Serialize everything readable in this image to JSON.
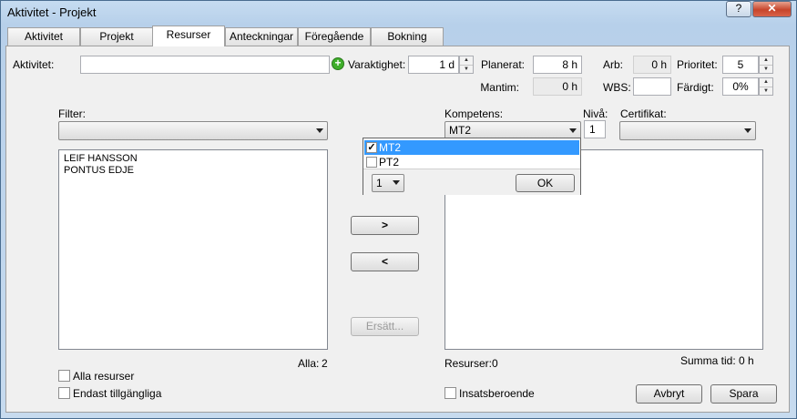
{
  "window": {
    "title": "Aktivitet - Projekt",
    "help_label": "?",
    "close_label": "✕"
  },
  "tabs": [
    {
      "label": "Aktivitet"
    },
    {
      "label": "Projekt"
    },
    {
      "label": "Resurser",
      "active": true
    },
    {
      "label": "Anteckningar"
    },
    {
      "label": "Föregående"
    },
    {
      "label": "Bokning"
    }
  ],
  "header": {
    "aktivitet_label": "Aktivitet:",
    "aktivitet_value": "",
    "varaktighet_label": "Varaktighet:",
    "varaktighet_value": "1 d",
    "planerat_label": "Planerat:",
    "planerat_value": "8 h",
    "arb_label": "Arb:",
    "arb_value": "0 h",
    "prioritet_label": "Prioritet:",
    "prioritet_value": "5",
    "mantim_label": "Mantim:",
    "mantim_value": "0 h",
    "wbs_label": "WBS:",
    "wbs_value": "",
    "fardigt_label": "Färdigt:",
    "fardigt_value": "0%"
  },
  "left": {
    "filter_label": "Filter:",
    "filter_value": "",
    "resources": [
      "LEIF HANSSON",
      "PONTUS EDJE"
    ],
    "count_label": "Alla:",
    "count_value": "2",
    "check_all": "Alla resurser",
    "check_available": "Endast tillgängliga"
  },
  "middle": {
    "add_label": ">",
    "remove_label": "<",
    "replace_label": "Ersätt..."
  },
  "right": {
    "kompetens_label": "Kompetens:",
    "kompetens_value": "MT2",
    "niva_label": "Nivå:",
    "niva_value": "1",
    "certifikat_label": "Certifikat:",
    "certifikat_value": "",
    "resurser_label": "Resurser:",
    "resurser_value": "0",
    "summa_label": "Summa tid: 0 h",
    "insats_label": "Insatsberoende"
  },
  "popup": {
    "options": [
      {
        "label": "MT2",
        "checked": true
      },
      {
        "label": "PT2",
        "checked": false
      }
    ],
    "level_value": "1",
    "ok_label": "OK"
  },
  "footer": {
    "cancel_label": "Avbryt",
    "save_label": "Spara"
  },
  "colors": {
    "accent": "#3399ff",
    "add_icon": "#3fae2a",
    "close": "#c7452b"
  }
}
